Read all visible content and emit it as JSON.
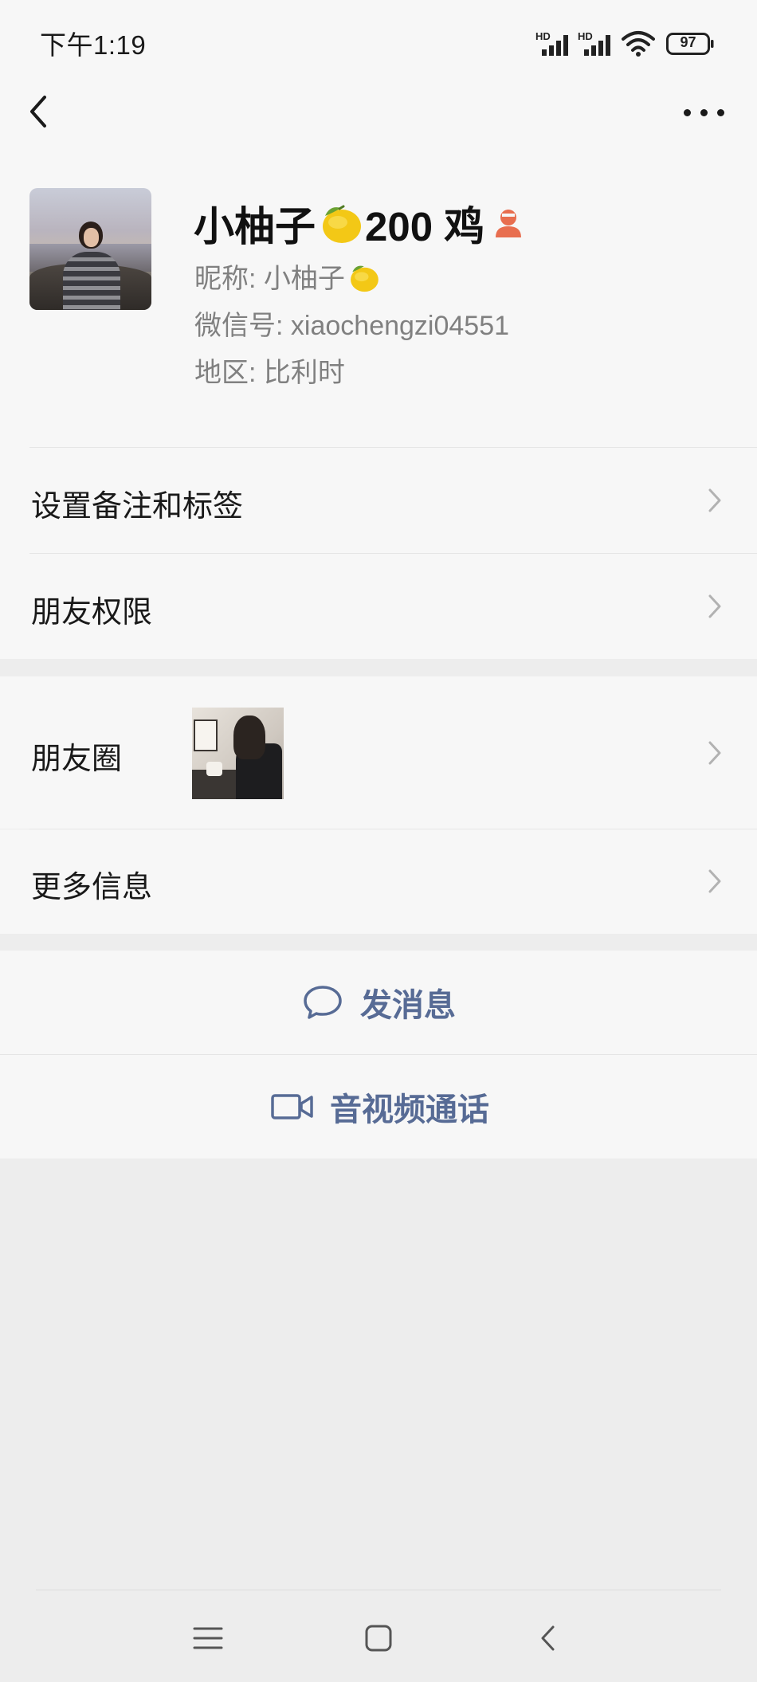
{
  "status_bar": {
    "time": "下午1:19",
    "signal_1_label": "HD",
    "signal_2_label": "HD",
    "battery_level": "97",
    "icons": [
      "signal-icon",
      "signal-icon",
      "wifi-icon",
      "battery-icon"
    ]
  },
  "header": {
    "back_icon": "back-arrow-icon",
    "more_icon": "more-dots-icon"
  },
  "profile": {
    "display_name_prefix": "小柚子",
    "display_name_suffix": "200 鸡",
    "lemon_icon": "lemon-emoji-icon",
    "badge_icon": "person-badge-icon",
    "nickname_label": "昵称:",
    "nickname_value": "小柚子",
    "wechat_id_label": "微信号:",
    "wechat_id_value": "xiaochengzi04551",
    "region_label": "地区:",
    "region_value": "比利时"
  },
  "menu": {
    "remark_tags": "设置备注和标签",
    "friend_permissions": "朋友权限",
    "moments": "朋友圈",
    "more_info": "更多信息"
  },
  "actions": {
    "send_message": "发消息",
    "video_call": "音视频通话"
  },
  "nav": {
    "icons": [
      "menu-icon",
      "home-icon",
      "back-icon"
    ]
  },
  "colors": {
    "background": "#ededed",
    "surface": "#f7f7f7",
    "link_blue": "#576b95",
    "badge_orange": "#e86e4f",
    "secondary_text": "#808080"
  }
}
